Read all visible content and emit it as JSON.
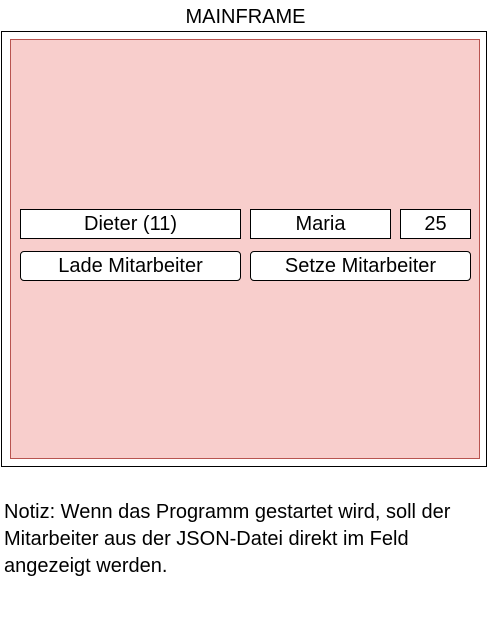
{
  "frame": {
    "title": "MAINFRAME"
  },
  "fields": {
    "employee": "Dieter (11)",
    "name": "Maria",
    "age": "25"
  },
  "buttons": {
    "load": "Lade Mitarbeiter",
    "set": "Setze Mitarbeiter"
  },
  "note": {
    "text": "Notiz: Wenn das Programm gestartet wird, soll der Mitarbeiter aus der JSON-Datei direkt im Feld angezeigt werden."
  },
  "colors": {
    "panel_fill": "#f8cecc",
    "panel_border": "#b85450"
  }
}
